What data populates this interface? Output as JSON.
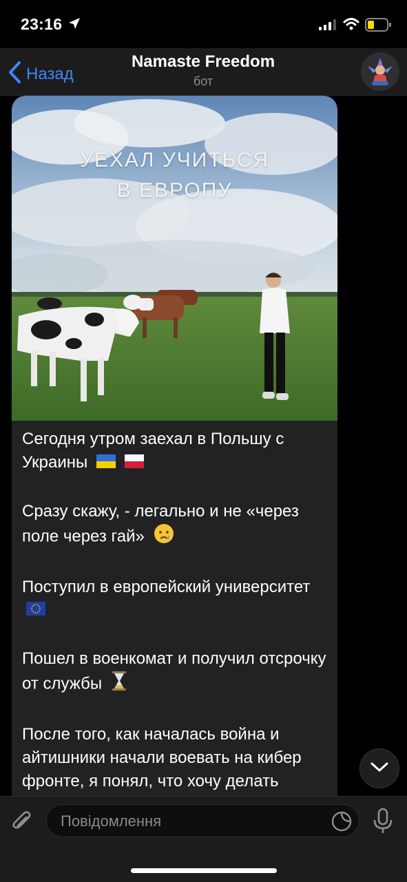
{
  "status_bar": {
    "time": "23:16"
  },
  "header": {
    "back_label": "Назад",
    "title": "Namaste Freedom",
    "subtitle": "бот"
  },
  "post": {
    "image_title_line1": "УЕХАЛ УЧИТЬСЯ",
    "image_title_line2": "В ЕВРОПУ",
    "p1": "Сегодня утром заехал в Польшу с Украины",
    "p2": "Сразу скажу, - легально и не «через поле через гай»",
    "p3": "Поступил в европейский университет",
    "p4": "Пошел в военкомат и получил отсрочку от службы",
    "p5": "После того, как началась война и айтишники начали воевать на кибер фронте, я понял, что хочу делать значительно больше, чем"
  },
  "input": {
    "placeholder": "Повідомлення"
  },
  "icons": {
    "back": "chevron-left-icon",
    "attach": "paperclip-icon",
    "sticker": "sticker-icon",
    "mic": "microphone-icon",
    "scroll": "chevron-down-icon",
    "flags": [
      "ukraine-flag-icon",
      "poland-flag-icon",
      "eu-flag-icon"
    ],
    "emoji": [
      "crying-face-icon",
      "hourglass-icon"
    ]
  },
  "colors": {
    "accent": "#3e88f7",
    "bubble": "#222224",
    "header": "#1c1c1d"
  }
}
